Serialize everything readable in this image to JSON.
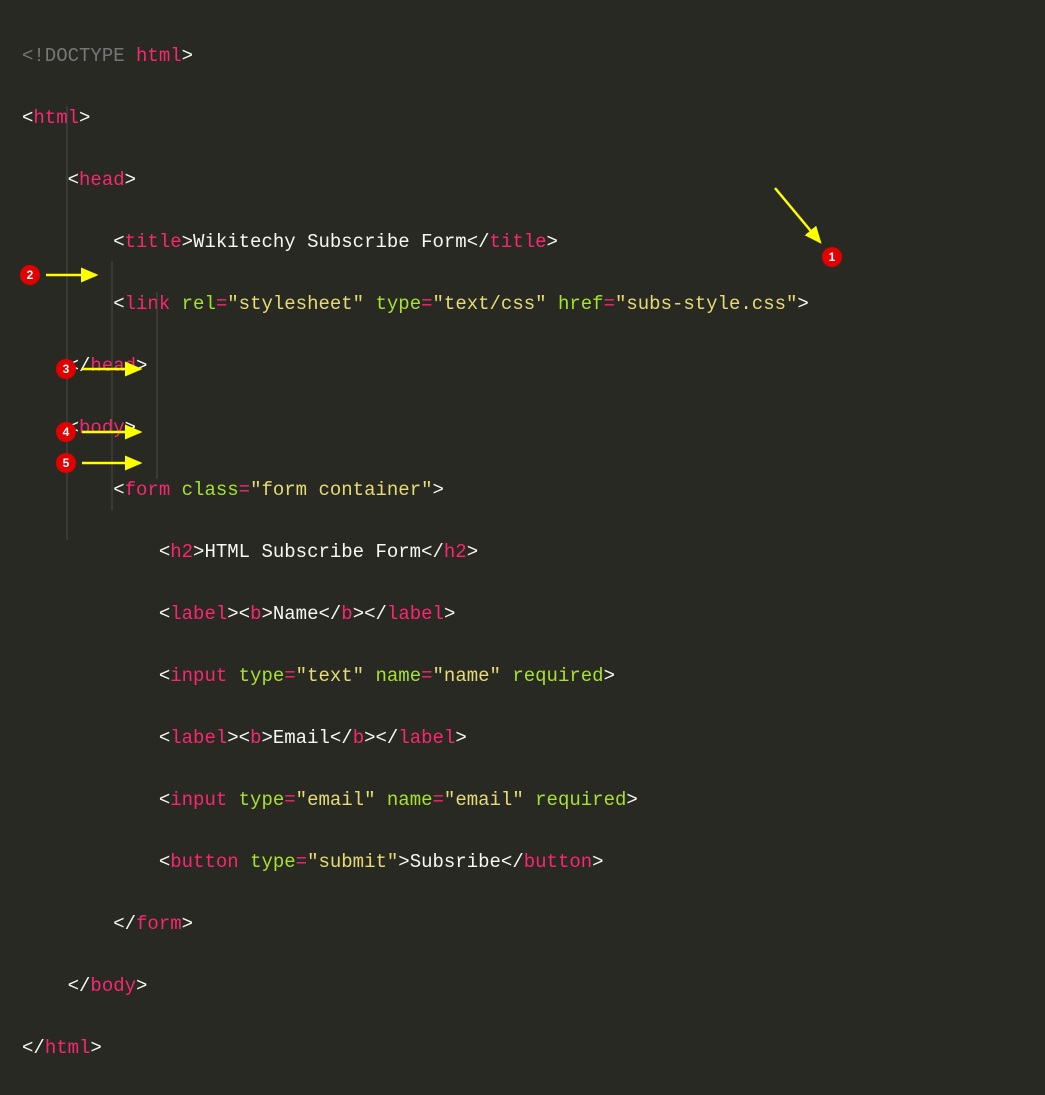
{
  "code": {
    "l1": "<!DOCTYPE",
    "l1b": " html",
    "l1c": ">",
    "tag_html": "html",
    "tag_head": "head",
    "tag_title": "title",
    "title_text": "Wikitechy Subscribe Form",
    "tag_link": "link",
    "attr_rel": "rel",
    "val_rel": "\"stylesheet\"",
    "attr_type": "type",
    "val_typecss": "\"text/css\"",
    "attr_href": "href",
    "val_href": "\"subs-style.css\"",
    "tag_body": "body",
    "tag_form": "form",
    "attr_class": "class",
    "val_class": "\"form container\"",
    "tag_h2": "h2",
    "h2_text": "HTML Subscribe Form",
    "tag_label": "label",
    "tag_b": "b",
    "label_name": "Name",
    "label_email": "Email",
    "tag_input": "input",
    "val_text": "\"text\"",
    "attr_name": "name",
    "val_name": "\"name\"",
    "val_email": "\"email\"",
    "attr_required": "required",
    "tag_button": "button",
    "val_submit": "\"submit\"",
    "btn_text": "Subsribe",
    "lt": "<",
    "gt": ">",
    "lts": "</",
    "eq": "="
  },
  "callouts": {
    "c1": "1",
    "c2": "2",
    "c3": "3",
    "c4": "4",
    "c5": "5"
  },
  "colors": {
    "bg": "#282923",
    "pink": "#f92672",
    "green": "#a6e22e",
    "yellow": "#e6db74",
    "gray": "#767679",
    "white": "#f8f8f2",
    "badge": "#e30000",
    "arrow": "#ffff00"
  }
}
